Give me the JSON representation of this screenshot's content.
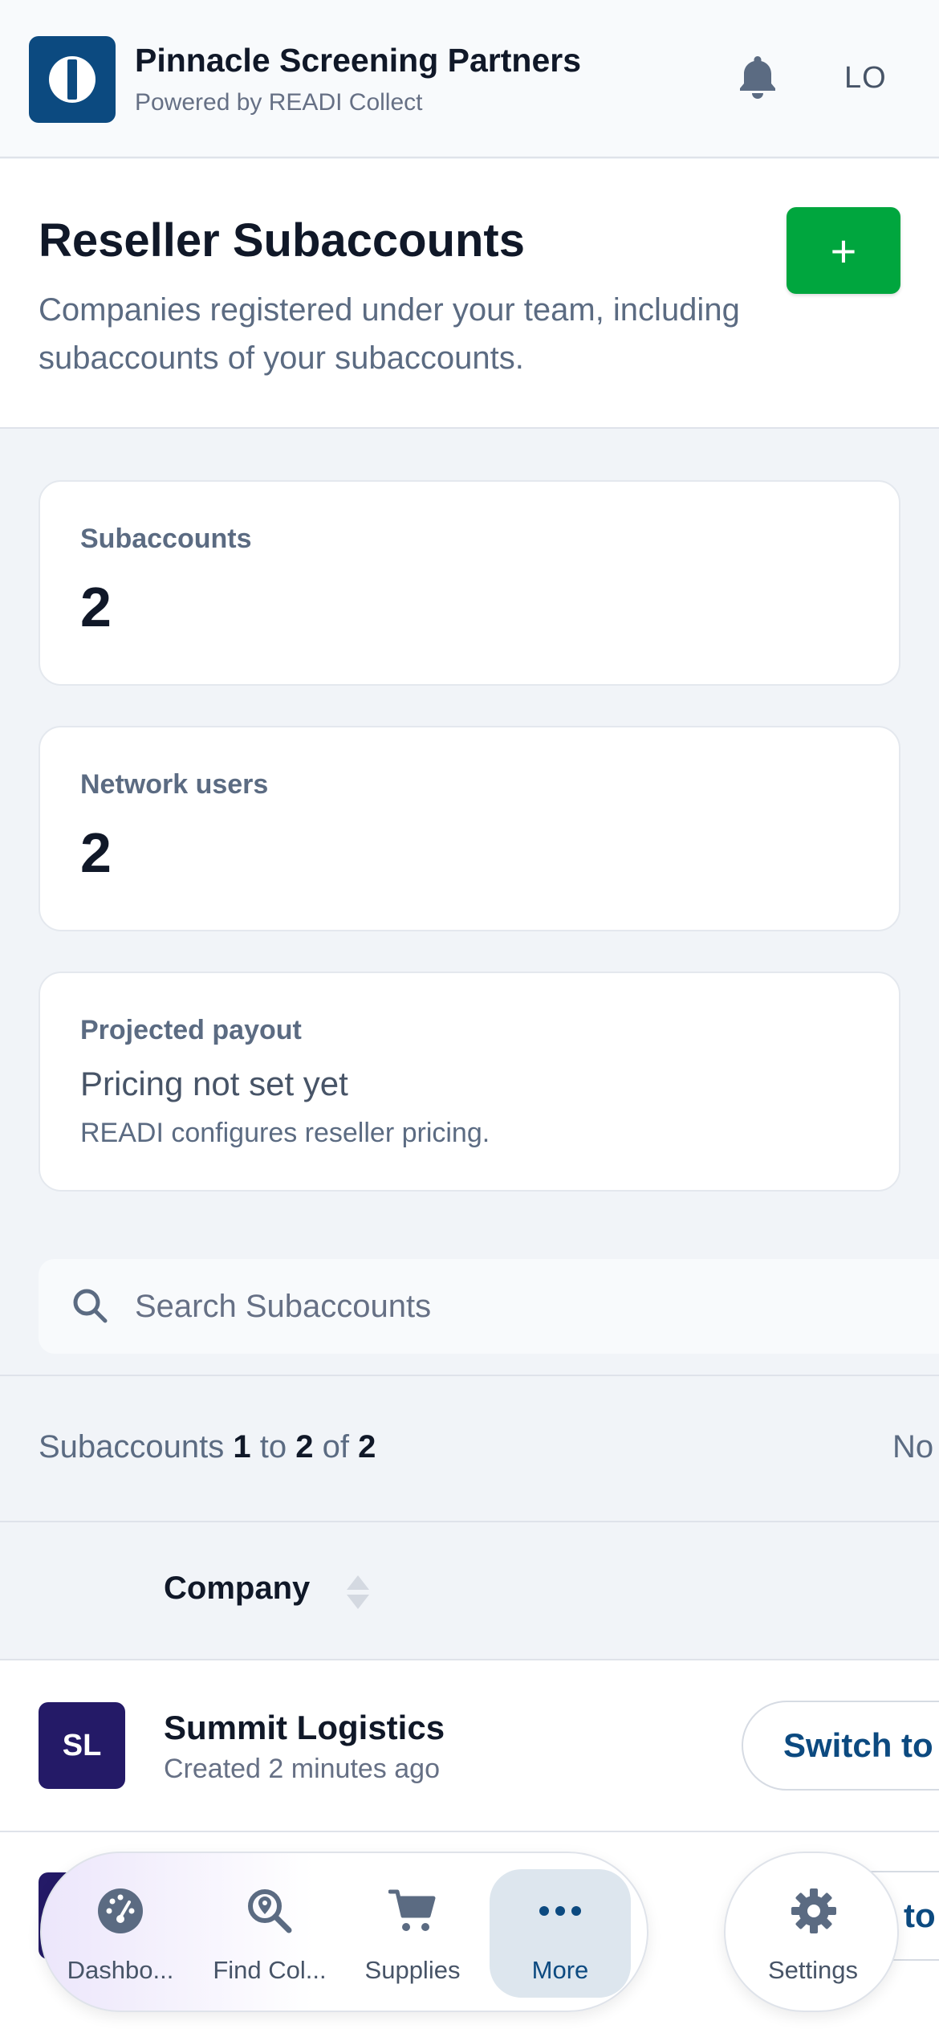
{
  "header": {
    "org_name": "Pinnacle Screening Partners",
    "org_subtitle": "Powered by READI Collect",
    "user_initials": "LO"
  },
  "page": {
    "title": "Reseller Subaccounts",
    "description": "Companies registered under your team, including subaccounts of your subaccounts.",
    "add_label": "+"
  },
  "stats": {
    "subaccounts": {
      "label": "Subaccounts",
      "value": "2"
    },
    "network_users": {
      "label": "Network users",
      "value": "2"
    },
    "payout": {
      "label": "Projected payout",
      "status": "Pricing not set yet",
      "note": "READI configures reseller pricing."
    }
  },
  "search": {
    "placeholder": "Search Subaccounts"
  },
  "pager": {
    "prefix": "Subaccounts",
    "from": "1",
    "to_word": "to",
    "to": "2",
    "of_word": "of",
    "total": "2",
    "right_text": "No"
  },
  "table": {
    "column_company": "Company",
    "rows": [
      {
        "initials": "SL",
        "name": "Summit Logistics",
        "created": "Created 2 minutes ago",
        "action": "Switch to"
      }
    ],
    "partial_row_action": "to"
  },
  "nav": {
    "items": [
      {
        "label": "Dashbo...",
        "icon": "dashboard-gauge-icon"
      },
      {
        "label": "Find Col...",
        "icon": "location-search-icon"
      },
      {
        "label": "Supplies",
        "icon": "shopping-cart-icon"
      },
      {
        "label": "More",
        "icon": "more-dots-icon",
        "active": true
      }
    ],
    "settings_label": "Settings"
  },
  "colors": {
    "brand": "#0c4a80",
    "add_button": "#00a63e",
    "avatar": "#241a67"
  }
}
